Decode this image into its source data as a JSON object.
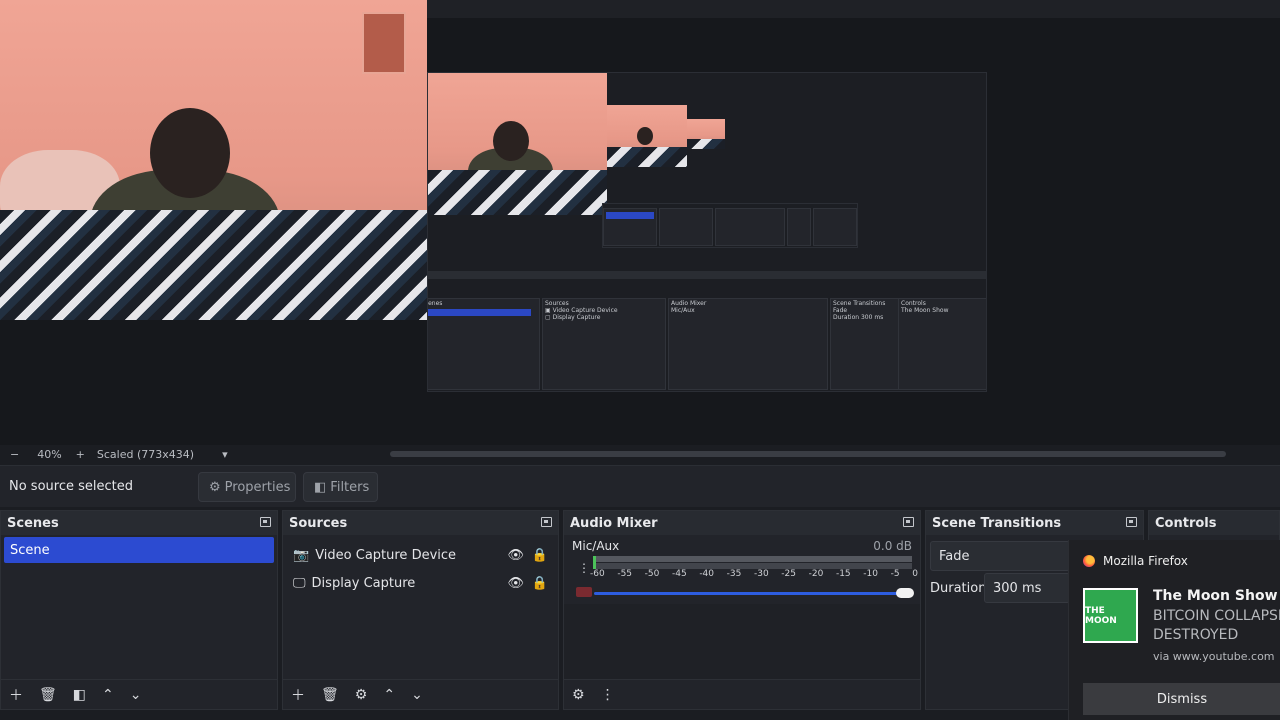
{
  "statusbar": {
    "zoom_minus": "−",
    "zoom_level": "40%",
    "zoom_plus": "+",
    "scale_mode": "Scaled (773x434)",
    "dropdown": "▾"
  },
  "properties_bar": {
    "no_source": "No source selected",
    "properties_label": "Properties",
    "filters_label": "Filters"
  },
  "scenes": {
    "title": "Scenes",
    "items": [
      "Scene"
    ]
  },
  "sources": {
    "title": "Sources",
    "items": [
      {
        "label": "Video Capture Device",
        "icon": "camera-icon"
      },
      {
        "label": "Display Capture",
        "icon": "monitor-icon"
      }
    ]
  },
  "audio_mixer": {
    "title": "Audio Mixer",
    "channel": "Mic/Aux",
    "level": "0.0 dB",
    "ticks": [
      "-60",
      "-55",
      "-50",
      "-45",
      "-40",
      "-35",
      "-30",
      "-25",
      "-20",
      "-15",
      "-10",
      "-5",
      "0"
    ]
  },
  "scene_transitions": {
    "title": "Scene Transitions",
    "transition": "Fade",
    "duration_label": "Duration",
    "duration_value": "300 ms"
  },
  "controls": {
    "title": "Controls"
  },
  "notification": {
    "app": "Mozilla Firefox",
    "title": "The Moon Show",
    "line1": "BITCOIN COLLAPSIN",
    "line2": "DESTROYED",
    "source": "via www.youtube.com",
    "dismiss": "Dismiss",
    "logo_text": "THE MOON"
  },
  "colors": {
    "accent": "#2c4bd1",
    "slider": "#2d5de0",
    "meter_green": "#4cc35a"
  }
}
